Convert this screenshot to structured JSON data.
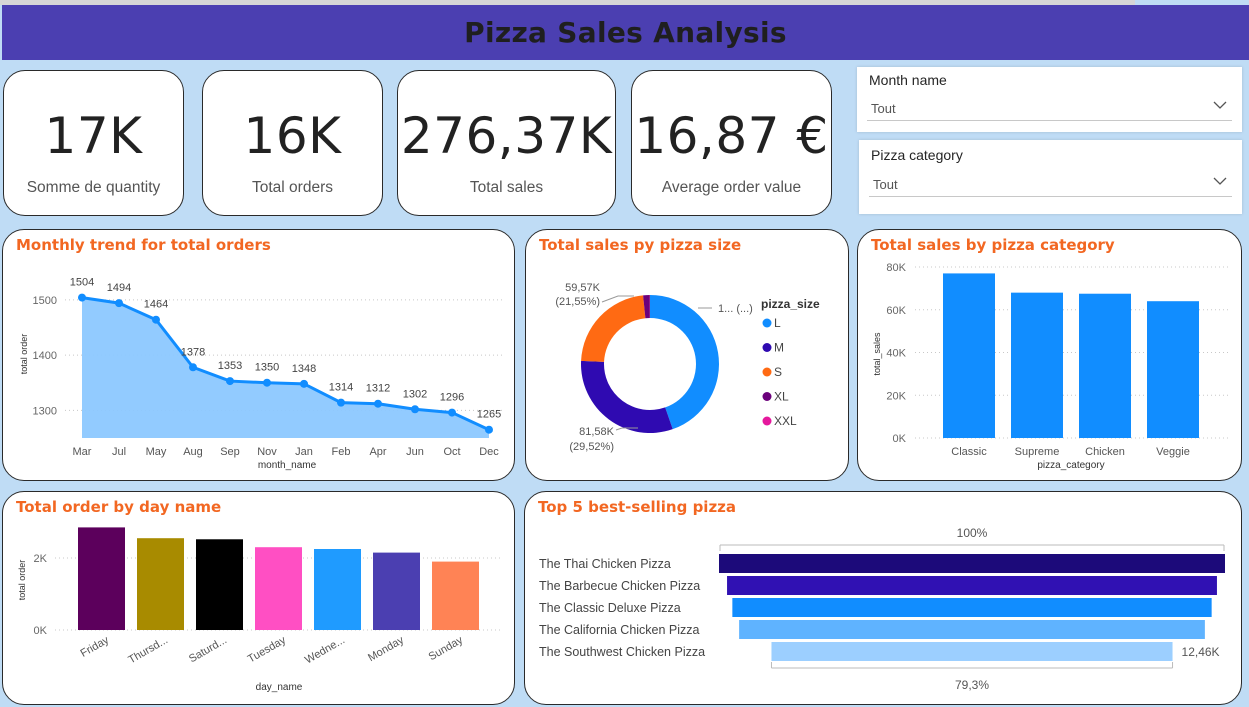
{
  "header": {
    "title": "Pizza Sales Analysis"
  },
  "kpis": [
    {
      "value": "17K",
      "label": "Somme de quantity"
    },
    {
      "value": "16K",
      "label": "Total orders"
    },
    {
      "value": "276,37K",
      "label": "Total sales"
    },
    {
      "value": "16,87 €",
      "label": "Average order value"
    }
  ],
  "slicers": [
    {
      "title": "Month name",
      "value": "Tout"
    },
    {
      "title": "Pizza category",
      "value": "Tout"
    }
  ],
  "colors": {
    "header": "#4b3fb1",
    "title_accent": "#f26722",
    "line": "#118dff",
    "area": "#8cc8ff",
    "bar": "#118dff"
  },
  "chart_data": [
    {
      "id": "monthly",
      "type": "area",
      "title": "Monthly trend for total orders",
      "xlabel": "month_name",
      "ylabel": "total order",
      "categories": [
        "Mar",
        "Jul",
        "May",
        "Aug",
        "Sep",
        "Nov",
        "Jan",
        "Feb",
        "Apr",
        "Jun",
        "Oct",
        "Dec"
      ],
      "values": [
        1504,
        1494,
        1464,
        1378,
        1353,
        1350,
        1348,
        1314,
        1312,
        1302,
        1296,
        1265
      ],
      "ylim": [
        1250,
        1525
      ],
      "yticks": [
        1300,
        1400,
        1500
      ],
      "grid": true
    },
    {
      "id": "size",
      "type": "pie",
      "title": "Total sales py pizza size",
      "legend_title": "pizza_size",
      "slices": [
        {
          "name": "L",
          "value": 117.3,
          "color": "#118dff"
        },
        {
          "name": "M",
          "value": 81.58,
          "color": "#2f0ab1"
        },
        {
          "name": "S",
          "value": 59.57,
          "color": "#ff6a13"
        },
        {
          "name": "XL",
          "value": 4.1,
          "color": "#6b007b"
        },
        {
          "name": "XXL",
          "value": 0.1,
          "color": "#e5189d"
        }
      ],
      "labels": [
        {
          "line1": "59,57K",
          "line2": "(21,55%)"
        },
        {
          "line1": "81,58K",
          "line2": "(29,52%)"
        },
        {
          "line1": "1... (...)",
          "line2": ""
        }
      ]
    },
    {
      "id": "category",
      "type": "bar",
      "title": "Total sales by pizza category",
      "xlabel": "pizza_category",
      "ylabel": "total_sales",
      "categories": [
        "Classic",
        "Supreme",
        "Chicken",
        "Veggie"
      ],
      "values": [
        77,
        68,
        67.5,
        64
      ],
      "ylim": [
        0,
        80
      ],
      "ytick_labels": [
        "0K",
        "20K",
        "40K",
        "60K",
        "80K"
      ],
      "yticks": [
        0,
        20,
        40,
        60,
        80
      ],
      "grid": true
    },
    {
      "id": "day",
      "type": "bar",
      "title": "Total order by day name",
      "xlabel": "day_name",
      "ylabel": "total order",
      "categories": [
        "Friday",
        "Thursd...",
        "Saturd...",
        "Tuesday",
        "Wedne...",
        "Monday",
        "Sunday"
      ],
      "values": [
        2850,
        2550,
        2520,
        2300,
        2250,
        2150,
        1900
      ],
      "colors": [
        "#5c005c",
        "#a88b00",
        "#000000",
        "#ff4fc3",
        "#1f9bff",
        "#4b3fb1",
        "#ff8355"
      ],
      "ylim": [
        0,
        3000
      ],
      "yticks": [
        0,
        2000
      ],
      "ytick_labels": [
        "0K",
        "2K"
      ],
      "grid": true
    },
    {
      "id": "funnel",
      "type": "bar",
      "title": "Top 5 best-selling pizza",
      "categories": [
        "The Thai Chicken Pizza",
        "The Barbecue Chicken Pizza",
        "The Classic Deluxe Pizza",
        "The California Chicken Pizza",
        "The Southwest Chicken Pizza"
      ],
      "values": [
        15.72,
        15.22,
        14.89,
        14.47,
        12.46
      ],
      "colors": [
        "#1c0a7a",
        "#3011b3",
        "#118dff",
        "#5fb3ff",
        "#9ccfff"
      ],
      "top_label": "100%",
      "bottom_label": "79,3%",
      "last_value_label": "12,46K"
    }
  ]
}
